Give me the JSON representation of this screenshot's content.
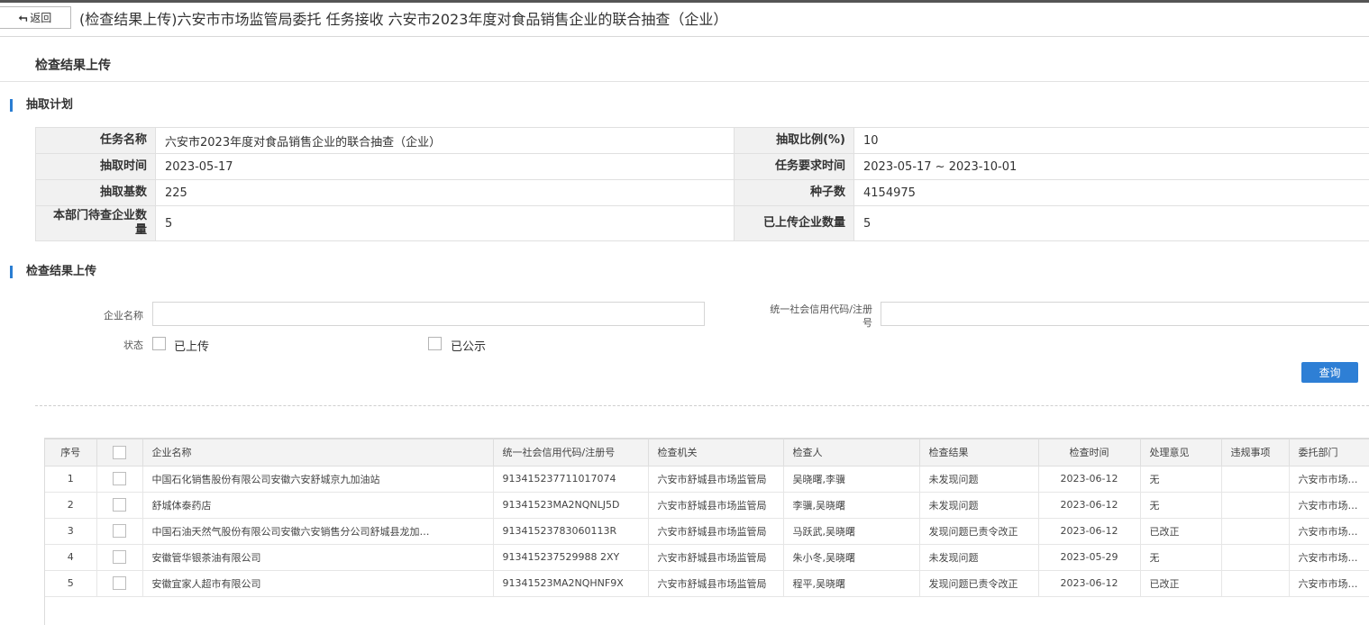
{
  "header": {
    "back_label": "返回",
    "title": "(检查结果上传)六安市市场监管局委托 任务接收 六安市2023年度对食品销售企业的联合抽查（企业）"
  },
  "page_title": "检查结果上传",
  "sections": {
    "plan": "抽取计划",
    "upload": "检查结果上传"
  },
  "plan": {
    "task_name_label": "任务名称",
    "task_name": "六安市2023年度对食品销售企业的联合抽查（企业）",
    "ratio_label": "抽取比例(%)",
    "ratio": "10",
    "draw_time_label": "抽取时间",
    "draw_time": "2023-05-17",
    "required_time_label": "任务要求时间",
    "required_time": "2023-05-17 ~ 2023-10-01",
    "base_label": "抽取基数",
    "base": "225",
    "seed_label": "种子数",
    "seed": "4154975",
    "pending_label": "本部门待查企业数量",
    "pending": "5",
    "uploaded_label": "已上传企业数量",
    "uploaded": "5"
  },
  "search": {
    "company_label": "企业名称",
    "company_value": "",
    "code_label": "统一社会信用代码/注册号",
    "code_value": "",
    "status_label": "状态",
    "opt_uploaded": "已上传",
    "opt_published": "已公示",
    "query_label": "查询"
  },
  "grid": {
    "headers": [
      "序号",
      "企业名称",
      "统一社会信用代码/注册号",
      "检查机关",
      "检查人",
      "检查结果",
      "检查时间",
      "处理意见",
      "违规事项",
      "委托部门"
    ],
    "rows": [
      {
        "no": "1",
        "name": "中国石化销售股份有限公司安徽六安舒城京九加油站",
        "code": "913415237711017074",
        "agency": "六安市舒城县市场监管局",
        "inspector": "吴晓曙,李骥",
        "result": "未发现问题",
        "date": "2023-06-12",
        "opinion": "无",
        "violation": "",
        "dept": "六安市市场监管局"
      },
      {
        "no": "2",
        "name": "舒城体泰药店",
        "code": "91341523MA2NQNLJ5D",
        "agency": "六安市舒城县市场监管局",
        "inspector": "李骥,吴晓曙",
        "result": "未发现问题",
        "date": "2023-06-12",
        "opinion": "无",
        "violation": "",
        "dept": "六安市市场监管局"
      },
      {
        "no": "3",
        "name": "中国石油天然气股份有限公司安徽六安销售分公司舒城县龙加…",
        "code": "91341523783060113R",
        "agency": "六安市舒城县市场监管局",
        "inspector": "马跃武,吴晓曙",
        "result": "发现问题已责令改正",
        "date": "2023-06-12",
        "opinion": "已改正",
        "violation": "",
        "dept": "六安市市场监管局"
      },
      {
        "no": "4",
        "name": "安徽管华银茶油有限公司",
        "code": "913415237529988 2XY",
        "agency": "六安市舒城县市场监管局",
        "inspector": "朱小冬,吴晓曙",
        "result": "未发现问题",
        "date": "2023-05-29",
        "opinion": "无",
        "violation": "",
        "dept": "六安市市场监管局"
      },
      {
        "no": "5",
        "name": "安徽宜家人超市有限公司",
        "code": "91341523MA2NQHNF9X",
        "agency": "六安市舒城县市场监管局",
        "inspector": "程平,吴晓曙",
        "result": "发现问题已责令改正",
        "date": "2023-06-12",
        "opinion": "已改正",
        "violation": "",
        "dept": "六安市市场监管局"
      }
    ]
  },
  "colors": {
    "accent": "#2e7fd5",
    "section_bar": "#2a7dd2"
  }
}
